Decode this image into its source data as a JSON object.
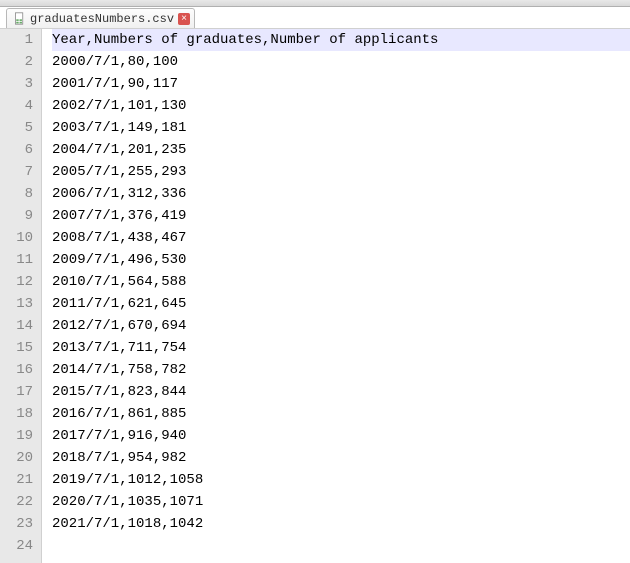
{
  "tab": {
    "filename": "graduatesNumbers.csv"
  },
  "editor": {
    "current_line": 1,
    "lines": [
      "Year,Numbers of graduates,Number of applicants",
      "2000/7/1,80,100",
      "2001/7/1,90,117",
      "2002/7/1,101,130",
      "2003/7/1,149,181",
      "2004/7/1,201,235",
      "2005/7/1,255,293",
      "2006/7/1,312,336",
      "2007/7/1,376,419",
      "2008/7/1,438,467",
      "2009/7/1,496,530",
      "2010/7/1,564,588",
      "2011/7/1,621,645",
      "2012/7/1,670,694",
      "2013/7/1,711,754",
      "2014/7/1,758,782",
      "2015/7/1,823,844",
      "2016/7/1,861,885",
      "2017/7/1,916,940",
      "2018/7/1,954,982",
      "2019/7/1,1012,1058",
      "2020/7/1,1035,1071",
      "2021/7/1,1018,1042",
      ""
    ]
  }
}
